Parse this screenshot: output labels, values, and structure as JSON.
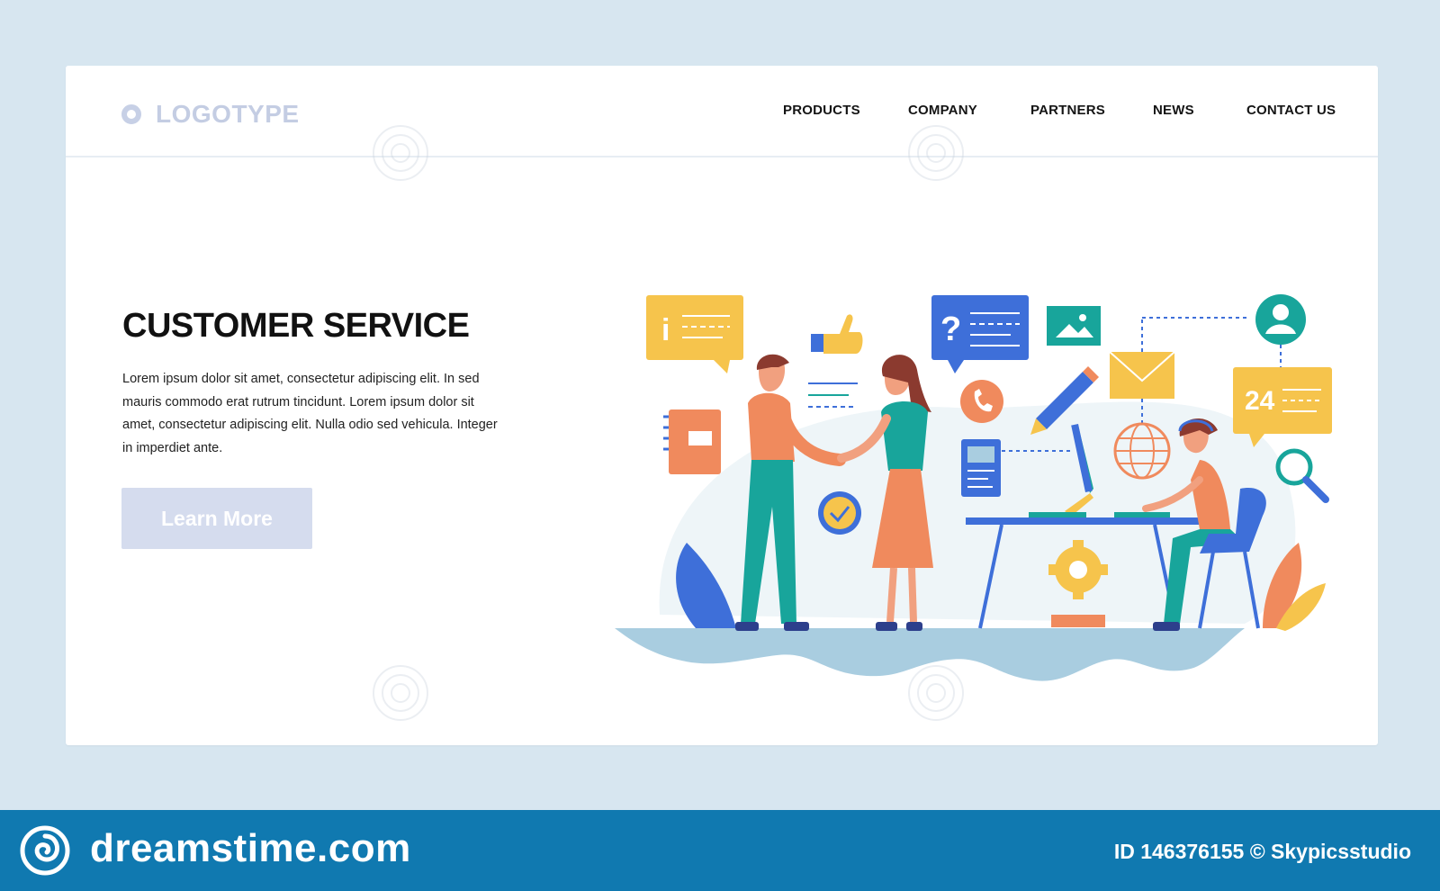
{
  "logo": {
    "text": "LOGOTYPE"
  },
  "nav": {
    "items": [
      {
        "label": "PRODUCTS"
      },
      {
        "label": "COMPANY"
      },
      {
        "label": "PARTNERS"
      },
      {
        "label": "NEWS"
      },
      {
        "label": "CONTACT US"
      }
    ]
  },
  "hero": {
    "title": "CUSTOMER SERVICE",
    "body": "Lorem ipsum dolor sit amet, consectetur adipiscing elit. In sed mauris commodo erat rutrum tincidunt. Lorem ipsum dolor sit amet, consectetur adipiscing elit. Nulla  odio sed vehicula. Integer in imperdiet ante.",
    "button_label": "Learn More"
  },
  "illustration": {
    "calendar_number": "24",
    "question_mark": "?",
    "info_mark": "i"
  },
  "footer": {
    "brand": "dreamstime.com",
    "credit": "ID 146376155 © Skypicsstudio"
  },
  "colors": {
    "page_bg": "#d7e6f0",
    "card_bg": "#ffffff",
    "footer_bar": "#1079b0",
    "button_bg": "#d5dcee",
    "accent_blue": "#2f6fe0",
    "accent_teal": "#18a59b",
    "accent_orange": "#f08a5d",
    "accent_yellow": "#f6c44c"
  },
  "icons": [
    "logo-mark-icon",
    "dreamstime-swirl-icon",
    "thumbs-up-icon",
    "phone-icon",
    "envelope-icon",
    "globe-icon",
    "gear-icon",
    "pencil-icon",
    "image-icon",
    "user-icon",
    "magnifier-icon",
    "checkmark-icon",
    "notebook-icon",
    "document-icon"
  ]
}
